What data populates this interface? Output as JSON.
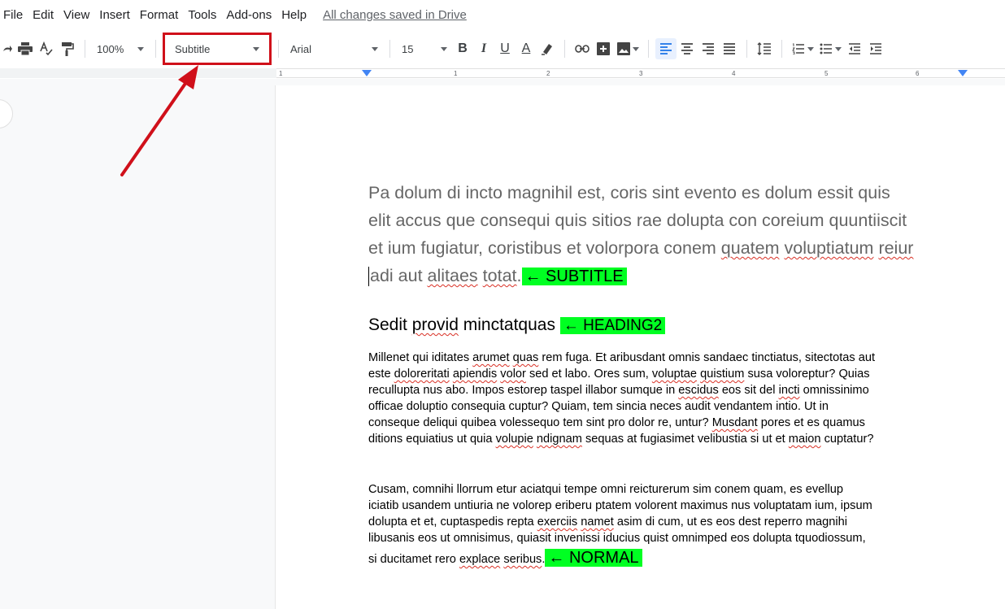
{
  "menubar": {
    "items": [
      "File",
      "Edit",
      "View",
      "Insert",
      "Format",
      "Tools",
      "Add-ons",
      "Help"
    ],
    "saved_status": "All changes saved in Drive"
  },
  "toolbar": {
    "zoom": "100%",
    "style": "Subtitle",
    "font": "Arial",
    "font_size": "15",
    "bold": "B",
    "italic": "I",
    "underline": "U",
    "text_color": "A"
  },
  "ruler": {
    "numbers": [
      "1",
      "1",
      "2",
      "3",
      "4",
      "5",
      "6"
    ]
  },
  "document": {
    "subtitle": {
      "line1": "Pa dolum di incto magnihil est, coris sint evento es dolum essit quis",
      "line2": "elit accus que consequi quis sitios rae dolupta con coreium quuntiiscit",
      "line3_a": "et ium fugiatur, coristibus et volorpora conem ",
      "line3_b": "quatem",
      "line3_c": " ",
      "line3_d": "voluptiatum",
      "line3_e": " ",
      "line3_f": "reiur",
      "line4_a": "adi aut ",
      "line4_b": "alitaes",
      "line4_c": " ",
      "line4_d": "totat",
      "line4_e": ".",
      "label": "← SUBTITLE"
    },
    "heading2": {
      "text_a": "Sedit ",
      "text_b": "provid",
      "text_c": " minctatquas ",
      "label": "← HEADING2"
    },
    "para1": {
      "l1_a": "Millenet qui iditates ",
      "l1_b": "arumet",
      "l1_c": " ",
      "l1_d": "quas",
      "l1_e": " rem fuga. Et aribusdant omnis sandaec tinctiatus, sitectotas aut",
      "l2_a": "este ",
      "l2_b": "doloreritati",
      "l2_c": " ",
      "l2_d": "apiendis",
      "l2_e": " ",
      "l2_f": "volor",
      "l2_g": " sed et labo. Ores sum, ",
      "l2_h": "voluptae",
      "l2_i": " ",
      "l2_j": "quistium",
      "l2_k": " susa voloreptur? Quias",
      "l3_a": "recullupta nus abo. Impos estorep taspel illabor sumque in ",
      "l3_b": "escidus",
      "l3_c": " eos sit del ",
      "l3_d": "incti",
      "l3_e": " omnissinimo",
      "l4": "officae doluptio consequia cuptur? Quiam, tem sincia neces audit vendantem intio. Ut in",
      "l5_a": "conseque deliqui quibea volessequo tem sint pro dolor re, untur? ",
      "l5_b": "Musdant",
      "l5_c": " pores et es quamus",
      "l6_a": "ditions equiatius ut quia ",
      "l6_b": "volupie",
      "l6_c": " ",
      "l6_d": "ndignam",
      "l6_e": " sequas at fugiasimet velibustia si ut et ",
      "l6_f": "maion",
      "l6_g": " cuptatur?"
    },
    "para2": {
      "l1": "Cusam, comnihi llorrum etur aciatqui tempe omni reicturerum sim conem quam, es evellup",
      "l2": "iciatib usandem untiuria ne volorep eriberu ptatem volorent maximus nus voluptatam ium, ipsum",
      "l3_a": "dolupta et et, cuptaspedis repta ",
      "l3_b": "exerciis",
      "l3_c": " ",
      "l3_d": "namet",
      "l3_e": " asim di cum, ut es eos dest reperro magnihi",
      "l4": "libusanis eos ut omnisimus, quiasit invenissi iducius quist omnimped eos dolupta tquodiossum,",
      "l5_a": "si ducitamet rero ",
      "l5_b": "explace",
      "l5_c": " ",
      "l5_d": "seribus",
      "l5_e": ".",
      "label": "← NORMAL"
    }
  },
  "colors": {
    "highlight": "#00ff22",
    "annotation": "#d0101a",
    "accent": "#4285f4"
  }
}
